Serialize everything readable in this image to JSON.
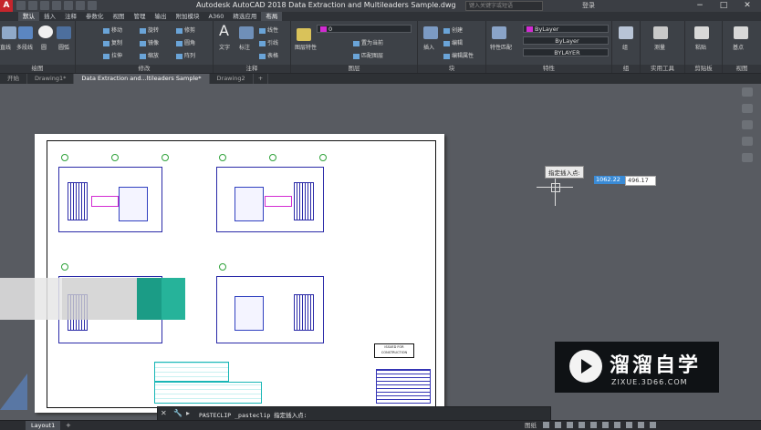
{
  "titlebar": {
    "app_logo": "A",
    "title": "Autodesk AutoCAD 2018    Data Extraction and Multileaders Sample.dwg",
    "search_placeholder": "键入关键字或短语",
    "login": "登录",
    "controls": [
      "−",
      "□",
      "✕"
    ]
  },
  "ribbon_tabs": [
    "默认",
    "插入",
    "注释",
    "参数化",
    "视图",
    "管理",
    "输出",
    "附加模块",
    "A360",
    "精选应用",
    "布局"
  ],
  "ribbon": {
    "draw": {
      "title": "绘图",
      "line": "直线",
      "polyline": "多段线",
      "circle": "圆",
      "arc": "圆弧"
    },
    "modify": {
      "title": "修改",
      "items": [
        "移动",
        "旋转",
        "修剪",
        "复制",
        "镜像",
        "圆角",
        "拉伸",
        "缩放",
        "阵列"
      ]
    },
    "annotation": {
      "title": "注释",
      "text": "文字",
      "dimension": "标注",
      "linear": "线性",
      "leader": "引线",
      "table": "表格"
    },
    "layers": {
      "title": "图层",
      "props": "图层特性",
      "make_current": "置为当前",
      "match": "匹配图层",
      "layer_value": "0"
    },
    "block": {
      "title": "块",
      "insert": "插入",
      "create": "创建",
      "edit": "编辑",
      "edit_attr": "编辑属性"
    },
    "properties": {
      "title": "特性",
      "match": "特性匹配",
      "color": "ByLayer",
      "lineweight": "ByLayer",
      "linetype": "BYLAYER"
    },
    "groups": {
      "title": "组",
      "group": "组"
    },
    "utilities": {
      "title": "实用工具",
      "measure": "测量"
    },
    "clipboard": {
      "title": "剪贴板",
      "paste": "粘贴"
    },
    "view": {
      "title": "视图",
      "base": "基点"
    }
  },
  "doc_tabs": [
    "开始",
    "Drawing1*",
    "Data Extraction and...ltileaders Sample*",
    "Drawing2",
    "+"
  ],
  "drawing": {
    "issued_label": "ISSUED FOR CONSTRUCTION"
  },
  "dynamic_input": {
    "prompt": "指定插入点:",
    "x": "1062.22",
    "y": "496.17"
  },
  "command_line": {
    "close": "✕",
    "wrench": "🔧",
    "prompt_icon": "▸",
    "text": "PASTECLIP _pasteclip 指定插入点:"
  },
  "statusbar": {
    "layout_tab": "Layout1",
    "plus": "+",
    "model": "图纸"
  },
  "watermark": {
    "title": "溜溜自学",
    "url": "ZIXUE.3D66.COM"
  },
  "colors": {
    "accent": "#3a8bd6",
    "ribbon_bg": "#3d4147",
    "canvas_bg": "#585b61",
    "logo_red": "#c5252c"
  }
}
